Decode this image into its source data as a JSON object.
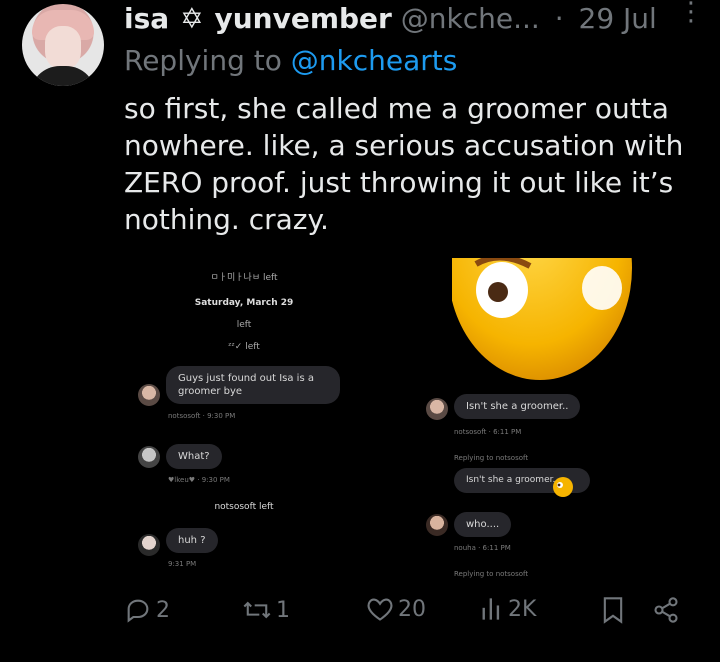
{
  "tweet": {
    "display_name": "isa",
    "name_suffix": "yunvember",
    "name_symbol": "✡",
    "handle": "@nkche...",
    "separator": "·",
    "date": "29 Jul",
    "reply_prefix": "Replying to",
    "reply_to": "@nkchearts",
    "text": "so first, she called me a groomer outta nowhere. like, a serious accusation with ZERO proof. just throwing it out like it’s nothing. crazy."
  },
  "media": {
    "left_chat": {
      "left_notice": "ㅁㅏ미ㅏ나ㅂ left",
      "date": "Saturday, March 29",
      "left1": "left",
      "left2": "ᶻᶻ✓ left",
      "msg1": "Guys just found out Isa is a groomer bye",
      "msg1_meta": "notsosoft · 9:30 PM",
      "msg2": "What?",
      "msg2_meta": "♥lkeu♥ · 9:30 PM",
      "left3": "notsosoft left",
      "msg3": "huh ?",
      "msg3_meta": "9:31 PM"
    },
    "right_chat": {
      "msg1": "Isn't she a groomer..",
      "msg1_meta": "notsosoft · 6:11 PM",
      "reply1": "Replying to notsosoft",
      "quoted": "Isn't she a groomer..",
      "msg2": "who....",
      "msg2_meta": "nouha · 6:11 PM",
      "reply2": "Replying to notsosoft"
    }
  },
  "actions": {
    "replies": "2",
    "reposts": "1",
    "likes": "20",
    "views": "2K"
  },
  "colors": {
    "background": "#000000",
    "text": "#e7e9ea",
    "muted": "#71767b",
    "link": "#1d9bf0"
  }
}
